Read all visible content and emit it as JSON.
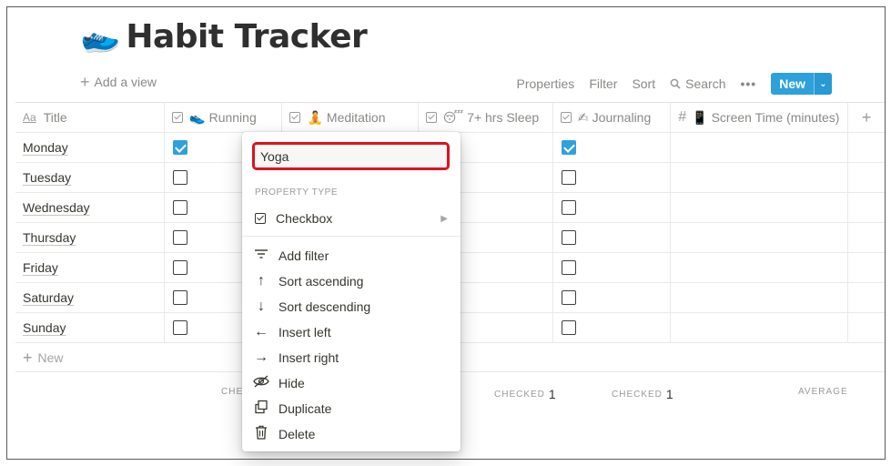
{
  "page": {
    "emoji": "sneaker-icon",
    "title": "Habit Tracker"
  },
  "toolbar": {
    "add_view": "Add a view",
    "properties": "Properties",
    "filter": "Filter",
    "sort": "Sort",
    "search": "Search",
    "more": "•••",
    "new_label": "New"
  },
  "table": {
    "columns": [
      {
        "label": "Title",
        "icon": "title-icon"
      },
      {
        "label": "Running",
        "icon": "checkbox-icon",
        "emoji": "👟"
      },
      {
        "label": "Meditation",
        "icon": "checkbox-icon",
        "emoji": "🧘"
      },
      {
        "label": "7+ hrs Sleep",
        "icon": "checkbox-icon",
        "emoji": "😴"
      },
      {
        "label": "Journaling",
        "icon": "checkbox-icon",
        "emoji": "✍"
      },
      {
        "label": "Screen Time (minutes)",
        "icon": "number-icon",
        "emoji": "📱"
      }
    ],
    "rows": [
      {
        "title": "Monday",
        "running": true,
        "journaling": true
      },
      {
        "title": "Tuesday",
        "running": false,
        "journaling": false
      },
      {
        "title": "Wednesday",
        "running": false,
        "journaling": false
      },
      {
        "title": "Thursday",
        "running": false,
        "journaling": false
      },
      {
        "title": "Friday",
        "running": false,
        "journaling": false
      },
      {
        "title": "Saturday",
        "running": false,
        "journaling": false
      },
      {
        "title": "Sunday",
        "running": false,
        "journaling": false
      }
    ],
    "new_row": "New"
  },
  "footer": {
    "running_label": "CHEC",
    "sleep_label": "CHECKED",
    "sleep_value": "1",
    "journaling_label": "CHECKED",
    "journaling_value": "1",
    "screen_label": "AVERAGE"
  },
  "menu": {
    "name_value": "Yoga",
    "property_type_label": "Property type",
    "property_type_value": "Checkbox",
    "items": [
      {
        "label": "Add filter",
        "icon": "filter-icon"
      },
      {
        "label": "Sort ascending",
        "icon": "arrow-up-icon"
      },
      {
        "label": "Sort descending",
        "icon": "arrow-down-icon"
      },
      {
        "label": "Insert left",
        "icon": "arrow-left-icon"
      },
      {
        "label": "Insert right",
        "icon": "arrow-right-icon"
      },
      {
        "label": "Hide",
        "icon": "eye-slash-icon"
      },
      {
        "label": "Duplicate",
        "icon": "duplicate-icon"
      },
      {
        "label": "Delete",
        "icon": "trash-icon"
      }
    ]
  },
  "colors": {
    "accent": "#2ea1dc",
    "highlight": "#e0111f"
  }
}
